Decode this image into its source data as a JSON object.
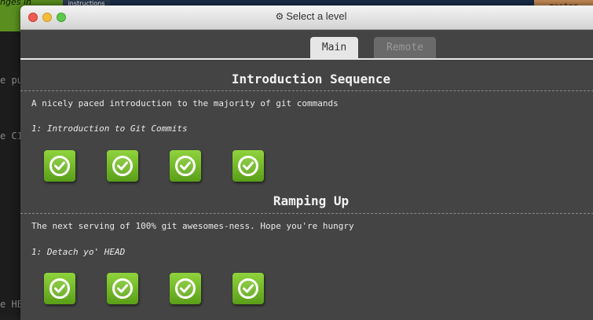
{
  "background_app": {
    "top_left_text": "nges in",
    "tab_label": "instructions",
    "branch_badge": "master",
    "code_fragments": [
      "e pu",
      "e C1",
      "e HE"
    ]
  },
  "window": {
    "title": "Select a level",
    "title_icon": "gear-icon"
  },
  "tabs": [
    {
      "label": "Main",
      "active": true
    },
    {
      "label": "Remote",
      "active": false
    }
  ],
  "sequences": [
    {
      "title": "Introduction Sequence",
      "description": "A nicely paced introduction to the majority of git commands",
      "subtitle": "1: Introduction to Git Commits",
      "levels": [
        {
          "status": "completed",
          "icon": "checkmark-icon"
        },
        {
          "status": "completed",
          "icon": "checkmark-icon"
        },
        {
          "status": "completed",
          "icon": "checkmark-icon"
        },
        {
          "status": "completed",
          "icon": "checkmark-icon"
        }
      ]
    },
    {
      "title": "Ramping Up",
      "description": "The next serving of 100% git awesomes-ness. Hope you're hungry",
      "subtitle": "1: Detach yo' HEAD",
      "levels": [
        {
          "status": "completed",
          "icon": "checkmark-icon"
        },
        {
          "status": "completed",
          "icon": "checkmark-icon"
        },
        {
          "status": "completed",
          "icon": "checkmark-icon"
        },
        {
          "status": "completed",
          "icon": "checkmark-icon"
        }
      ]
    }
  ],
  "colors": {
    "window_bg": "#444444",
    "level_green": "#6fb822",
    "text": "#eaeaea"
  }
}
